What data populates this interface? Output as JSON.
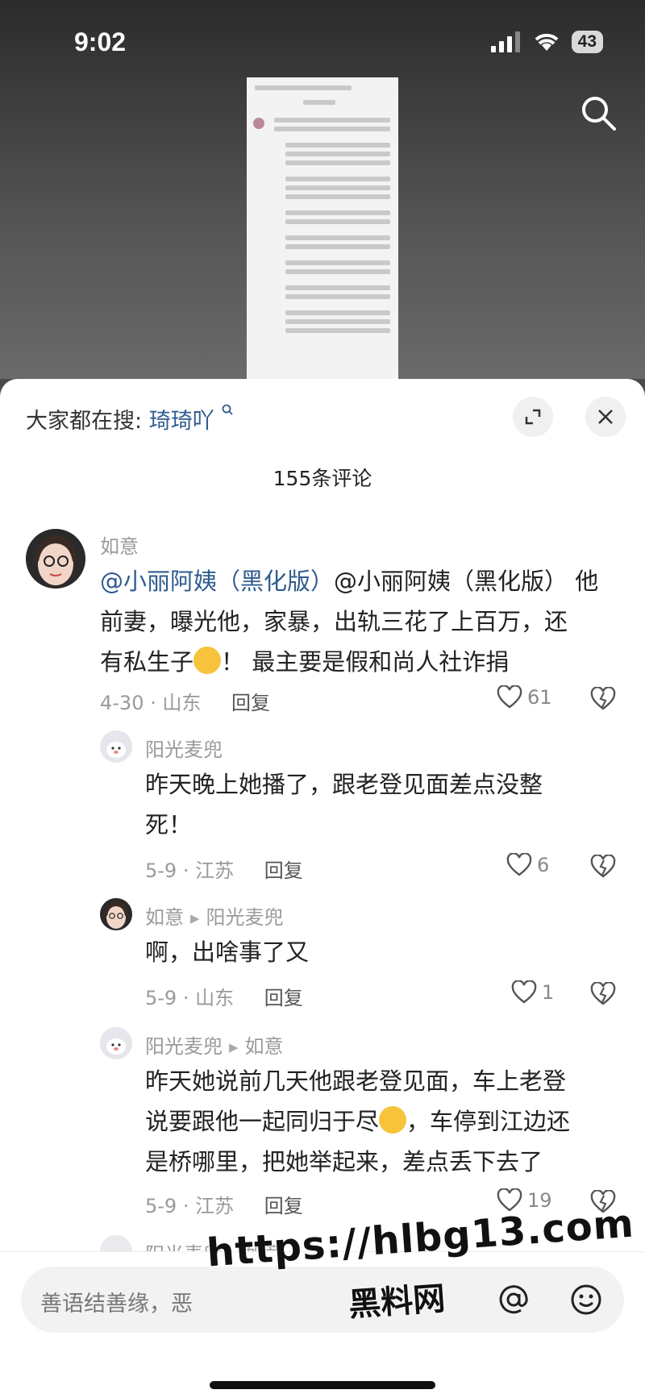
{
  "status_bar": {
    "time": "9:02",
    "battery": "43"
  },
  "sheet": {
    "search_prefix": "大家都在搜:",
    "search_keyword": "琦琦吖",
    "comment_count": "155条评论"
  },
  "comments": [
    {
      "user": "如意",
      "mention": "@小丽阿姨（黑化版）",
      "text_line1_rest": "@小丽阿姨（黑化版） 他",
      "text_line2": "前妻，曝光他，家暴，出轨三花了上百万，还",
      "text_line3_a": "有私生子",
      "text_line3_b": "！ 最主要是假和尚人社诈捐",
      "date_loc": "4-30 · 山东",
      "reply_label": "回复",
      "likes": "61"
    },
    {
      "user": "阳光麦兜",
      "text_line1": "昨天晚上她播了，跟老登见面差点没整",
      "text_line2": "死！",
      "date_loc": "5-9 · 江苏",
      "reply_label": "回复",
      "likes": "6"
    },
    {
      "user": "如意",
      "reply_to": "阳光麦兜",
      "text_line1": "啊，出啥事了又",
      "date_loc": "5-9 · 山东",
      "reply_label": "回复",
      "likes": "1"
    },
    {
      "user": "阳光麦兜",
      "reply_to": "如意",
      "text_line1": "昨天她说前几天他跟老登见面，车上老登",
      "text_line2_a": "说要跟他一起同归于尽",
      "text_line2_b": "，车停到江边还",
      "text_line3": "是桥哪里，把她举起来，差点丢下去了",
      "date_loc": "5-9 · 江苏",
      "reply_label": "回复",
      "likes": "19"
    },
    {
      "user": "阳光麦兜",
      "reply_to": "如意"
    }
  ],
  "input": {
    "placeholder": "善语结善缘，恶"
  },
  "watermark": {
    "url": "https://hlbg13.com",
    "site": "黑料网"
  },
  "colors": {
    "accent": "#2f5c8f",
    "sheet_bg": "#ffffff",
    "muted": "#9a9a9a"
  }
}
